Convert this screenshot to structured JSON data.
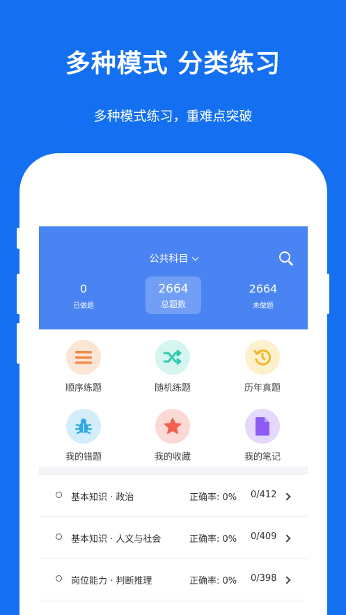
{
  "promo": {
    "headline": "多种模式 分类练习",
    "subline": "多种模式练习，重难点突破"
  },
  "app": {
    "subject": "公共科目",
    "stats": {
      "done": {
        "value": "0",
        "label": "已做题"
      },
      "total": {
        "value": "2664",
        "label": "总题数"
      },
      "undone": {
        "value": "2664",
        "label": "未做题"
      }
    },
    "functions": [
      {
        "label": "顺序练题",
        "icon": "list-icon",
        "color": "#f08a4b",
        "bg": "#fde5d6"
      },
      {
        "label": "随机练题",
        "icon": "shuffle-icon",
        "color": "#2fc9b2",
        "bg": "#d5f6f0"
      },
      {
        "label": "历年真题",
        "icon": "history-icon",
        "color": "#f1b62a",
        "bg": "#fdf0cc"
      },
      {
        "label": "我的错题",
        "icon": "bug-icon",
        "color": "#2ea8e6",
        "bg": "#d3edfa"
      },
      {
        "label": "我的收藏",
        "icon": "star-icon",
        "color": "#f2604f",
        "bg": "#fcd9d5"
      },
      {
        "label": "我的笔记",
        "icon": "note-icon",
        "color": "#8e5cf5",
        "bg": "#e4d9fd"
      }
    ],
    "categories": [
      {
        "title": "基本知识 · 政治",
        "rate": "正确率:  0%",
        "count": "0/412"
      },
      {
        "title": "基本知识 · 人文与社会",
        "rate": "正确率:  0%",
        "count": "0/409"
      },
      {
        "title": "岗位能力 · 判断推理",
        "rate": "正确率:  0%",
        "count": "0/398"
      }
    ]
  }
}
